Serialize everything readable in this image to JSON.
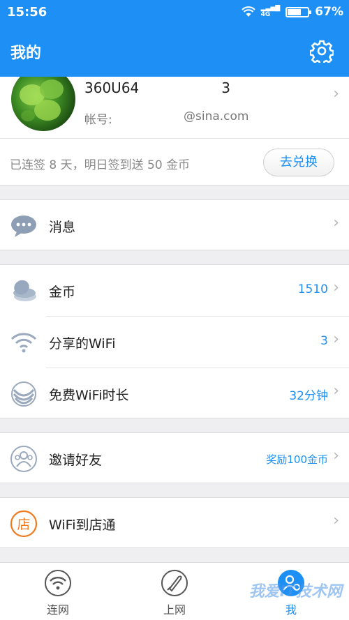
{
  "status_bar": {
    "time": "15:56",
    "network": "4G",
    "battery": "67%",
    "battery_level": 0.67
  },
  "header": {
    "title": "我的"
  },
  "profile": {
    "username": "360U64",
    "username_tail": "3",
    "account_label": "帐号:",
    "account_email": "@sina.com"
  },
  "checkin": {
    "text": "已连签 8 天，明日签到送 50 金币",
    "button": "去兑换"
  },
  "menu": {
    "messages": {
      "label": "消息"
    },
    "coins": {
      "label": "金币",
      "value": "1510"
    },
    "shared_wifi": {
      "label": "分享的WiFi",
      "value": "3"
    },
    "free_wifi": {
      "label": "免费WiFi时长",
      "value": "32分钟"
    },
    "invite": {
      "label": "邀请好友",
      "value": "奖励100金币"
    },
    "store": {
      "label": "WiFi到店通"
    }
  },
  "tabs": {
    "connect": "连网",
    "browse": "上网",
    "me": "我"
  },
  "watermark": "我爱IT技术网",
  "colors": {
    "accent": "#1e90f5",
    "background": "#efeff1"
  }
}
